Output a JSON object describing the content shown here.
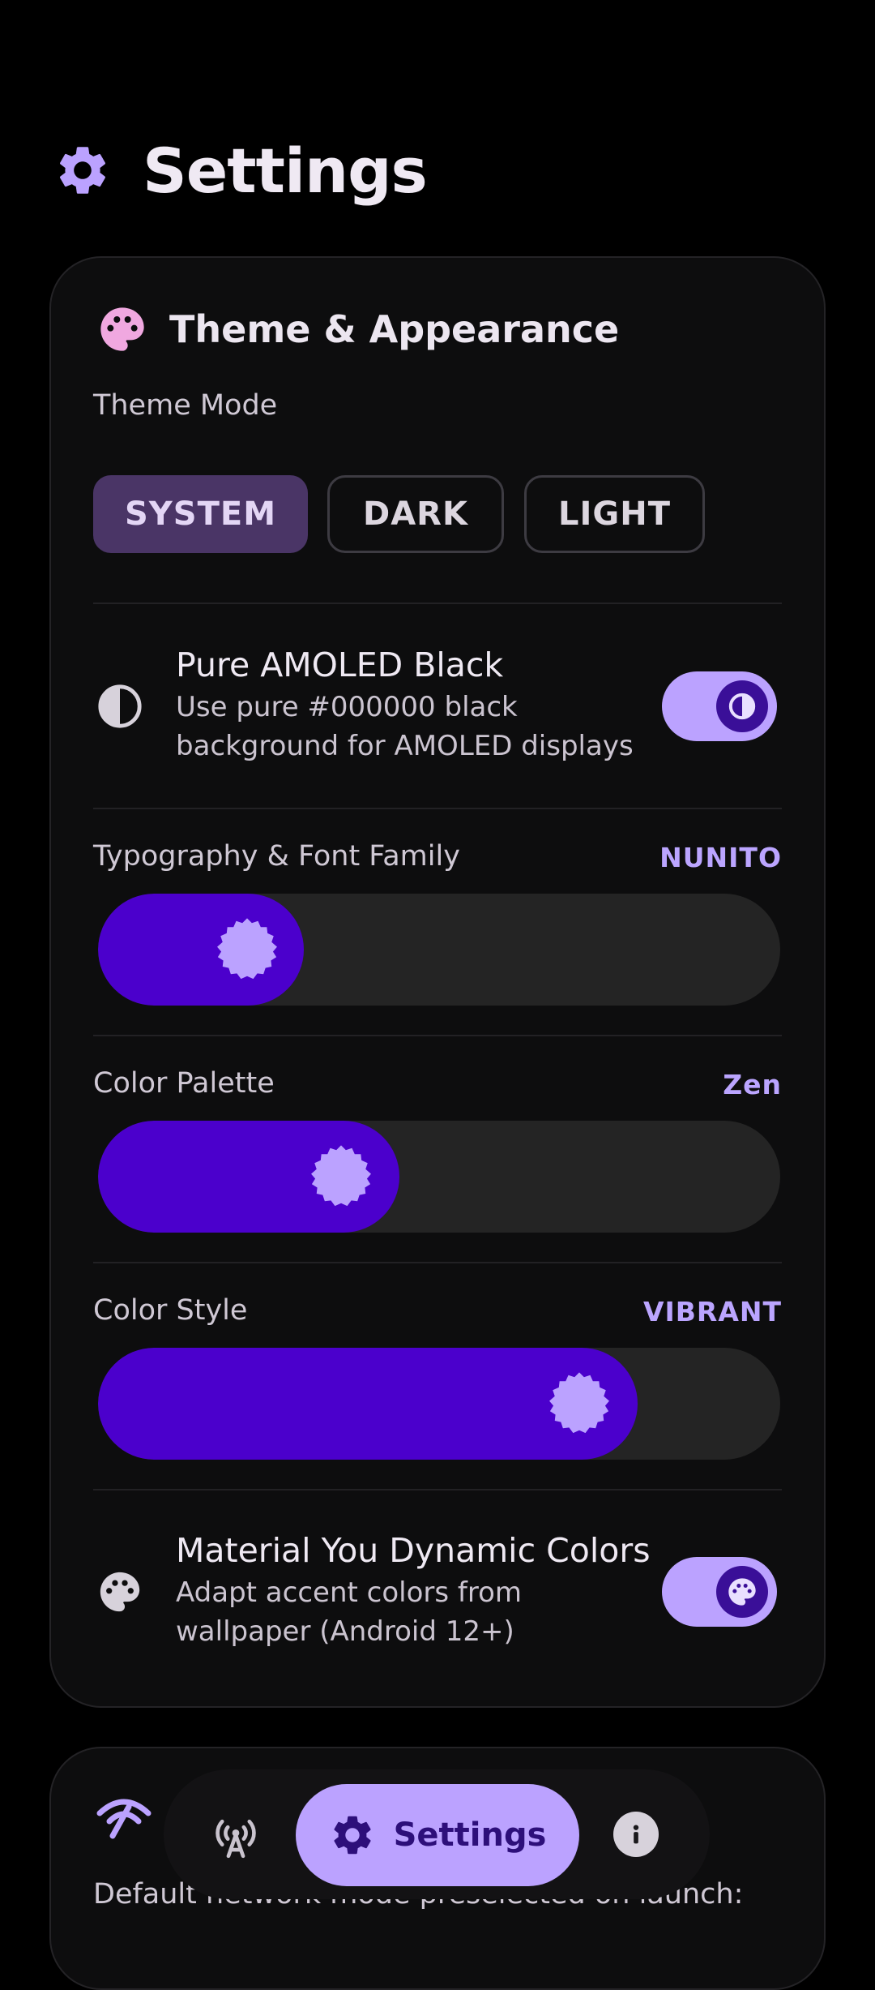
{
  "header": {
    "title": "Settings"
  },
  "theme_card": {
    "heading": "Theme & Appearance",
    "theme_mode_label": "Theme Mode",
    "theme_modes": [
      "SYSTEM",
      "DARK",
      "LIGHT"
    ],
    "selected_mode": "SYSTEM",
    "amoled": {
      "title": "Pure AMOLED Black",
      "subtitle": "Use pure #000000 black background for AMOLED displays",
      "enabled": true
    },
    "typography": {
      "label": "Typography & Font Family",
      "value": "NUNITO",
      "level": 0.22
    },
    "palette": {
      "label": "Color Palette",
      "value": "Zen",
      "level": 0.36
    },
    "style": {
      "label": "Color Style",
      "value": "VIBRANT",
      "level": 0.72
    },
    "dynamic": {
      "title": "Material You Dynamic Colors",
      "subtitle": "Adapt accent colors from wallpaper (Android 12+)",
      "enabled": true
    }
  },
  "network_card": {
    "label": "Default network mode preselected on launch:"
  },
  "bottom_nav": {
    "items": [
      "radio",
      "Settings",
      "info"
    ],
    "active_label": "Settings"
  },
  "colors": {
    "accent": "#bba2ff",
    "slider_fill": "#4b00cc",
    "selected_segment": "#4a3566",
    "background": "#000000",
    "card": "#0d0d0e"
  },
  "icons": {
    "header": "gear-icon",
    "theme": "palette-icon",
    "amoled": "contrast-icon",
    "dynamic": "palette-icon",
    "network": "network-icon",
    "nav_radio": "radio-tower-icon",
    "nav_settings": "gear-icon",
    "nav_info": "info-icon"
  }
}
